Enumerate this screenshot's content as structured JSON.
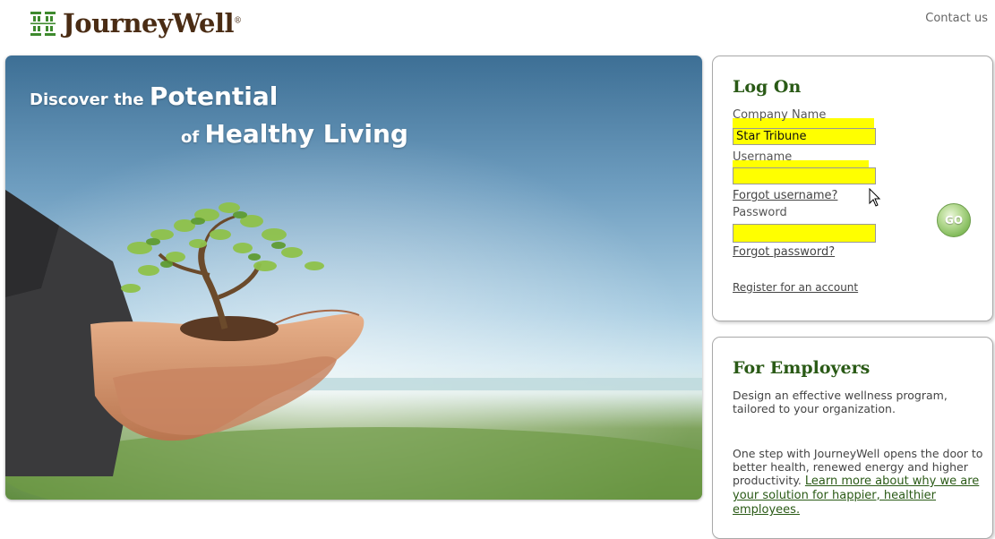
{
  "header": {
    "brand": "JourneyWell",
    "brand_mark": "sunburst-logo-icon",
    "trademark": "®",
    "contact_label": "Contact us"
  },
  "hero": {
    "line1_small": "Discover the ",
    "line1_big": "Potential",
    "line2_small": "of ",
    "line2_big": "Healthy Living"
  },
  "login": {
    "title": "Log On",
    "company_label": "Company Name",
    "company_value": "Star Tribune",
    "username_label": "Username",
    "username_value": "",
    "forgot_username": "Forgot username?",
    "password_label": "Password",
    "password_value": "",
    "forgot_password": "Forgot password?",
    "register": "Register for an account",
    "go_label": "GO"
  },
  "employers": {
    "title": "For Employers",
    "para1": "Design an effective wellness program, tailored to your organization.",
    "para2_text": "One step with JourneyWell opens the door to better health, renewed energy and higher productivity. ",
    "para2_link": "Learn more about why we are your solution for happier, healthier employees."
  },
  "colors": {
    "brand_brown": "#4a2c14",
    "title_green": "#2a5a16",
    "highlight": "#ffff00",
    "go_green": "#7fb957"
  }
}
